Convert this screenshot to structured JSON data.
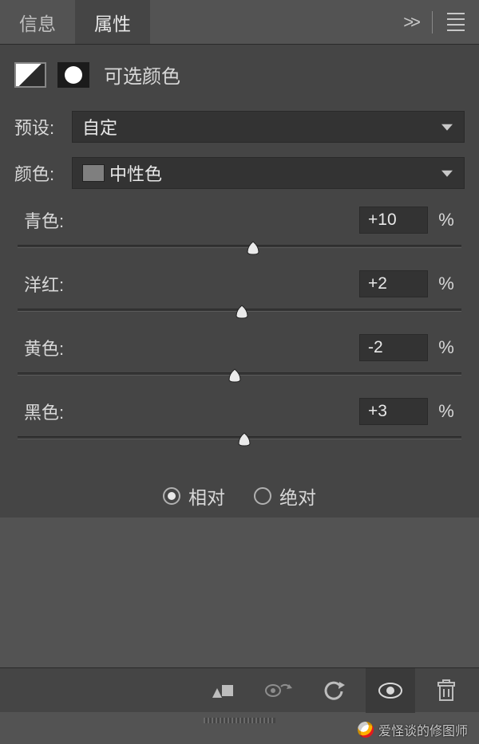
{
  "tabs": {
    "info": "信息",
    "properties": "属性"
  },
  "header_title": "可选颜色",
  "preset": {
    "label": "预设:",
    "value": "自定"
  },
  "color": {
    "label": "颜色:",
    "value": "中性色"
  },
  "sliders": [
    {
      "name": "青色:",
      "value": "+10",
      "pos": 53
    },
    {
      "name": "洋红:",
      "value": "+2",
      "pos": 50.5
    },
    {
      "name": "黄色:",
      "value": "-2",
      "pos": 49
    },
    {
      "name": "黑色:",
      "value": "+3",
      "pos": 51
    }
  ],
  "unit": "%",
  "mode": {
    "relative": "相对",
    "absolute": "绝对",
    "selected": "relative"
  },
  "watermark": "爱怪谈的修图师"
}
